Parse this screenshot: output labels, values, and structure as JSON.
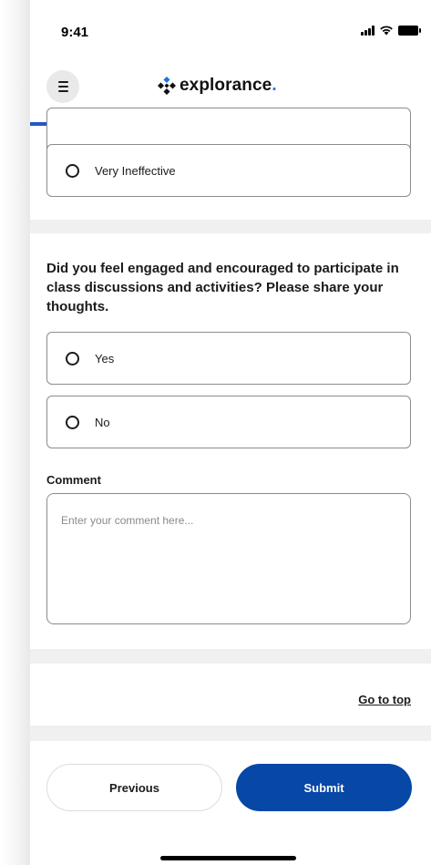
{
  "status_bar": {
    "time": "9:41"
  },
  "header": {
    "brand_name": "explorance",
    "brand_dot": ".",
    "brand_color": "#1a73e8",
    "progress": 0.83
  },
  "previous_question": {
    "options": [
      {
        "label": "Very Ineffective"
      }
    ]
  },
  "question": {
    "text": "Did you feel engaged and encouraged to participate in class discussions and activities? Please share your thoughts.",
    "options": [
      {
        "label": "Yes"
      },
      {
        "label": "No"
      }
    ],
    "comment_label": "Comment",
    "comment_placeholder": "Enter your comment here...",
    "comment_value": ""
  },
  "go_to_top_label": "Go to top",
  "footer": {
    "previous_label": "Previous",
    "submit_label": "Submit",
    "submit_color": "#0747a6"
  }
}
